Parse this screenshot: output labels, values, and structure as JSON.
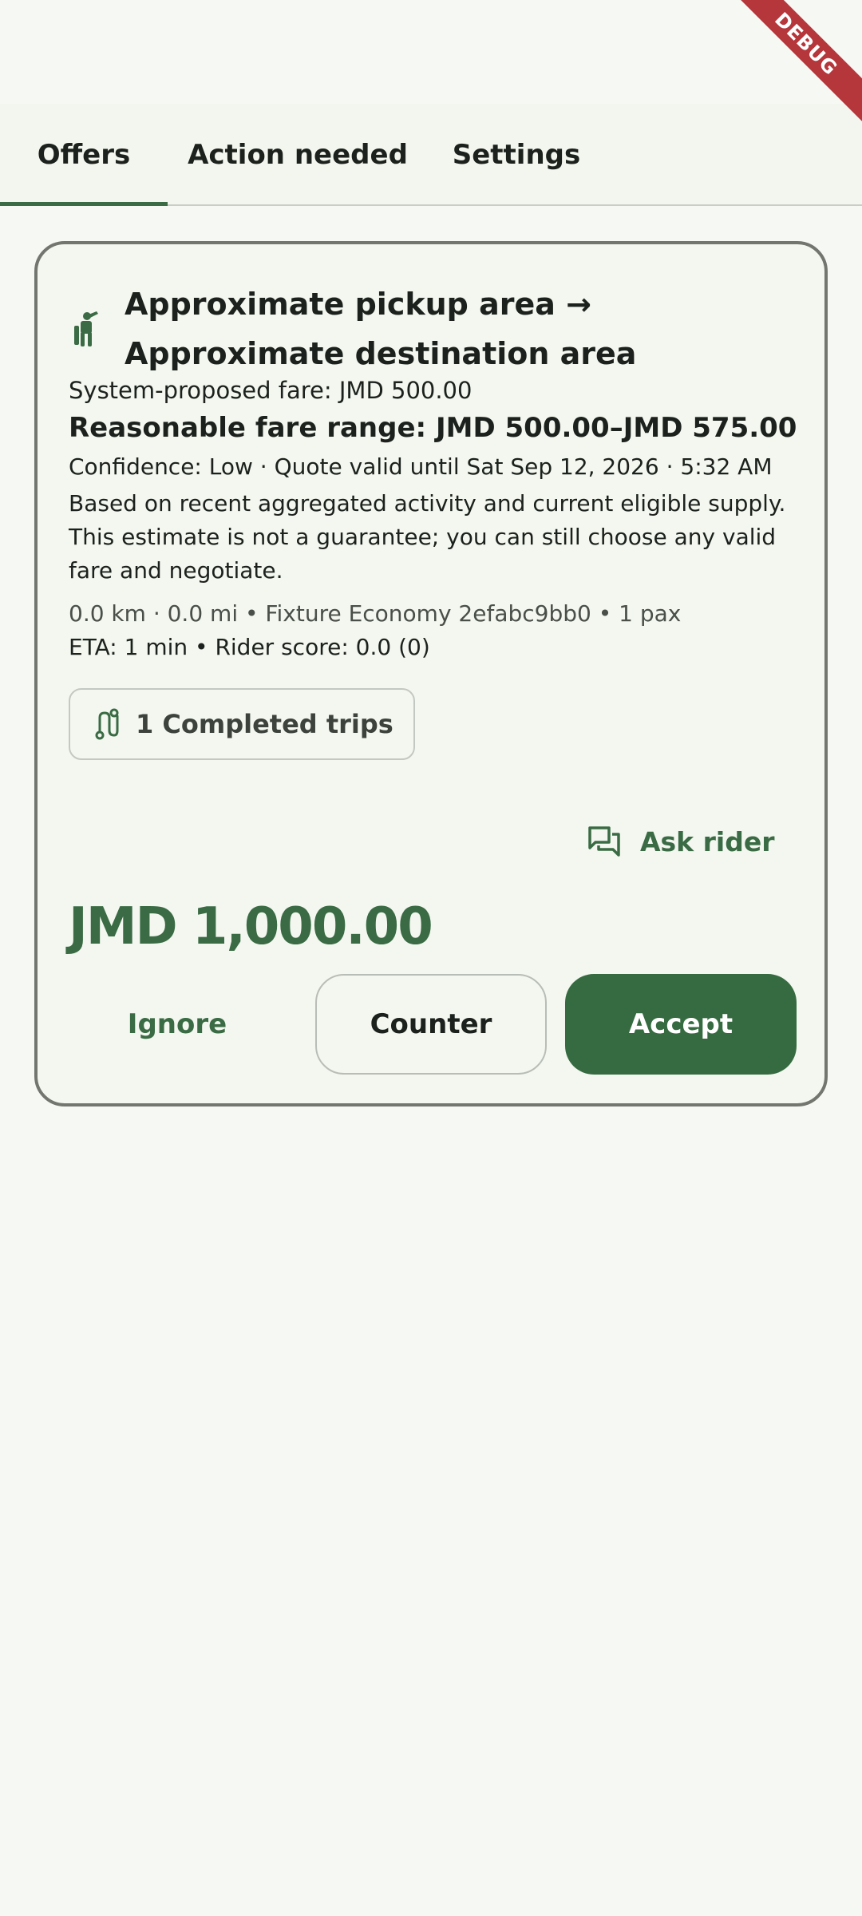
{
  "debug_banner": {
    "label": "DEBUG"
  },
  "tabs": [
    {
      "label": "Offers",
      "selected": true
    },
    {
      "label": "Action needed",
      "selected": false
    },
    {
      "label": "Settings",
      "selected": false
    }
  ],
  "offer": {
    "route_title": "Approximate pickup area → Approximate destination area",
    "system_fare": "System-proposed fare: JMD 500.00",
    "fare_range": "Reasonable fare range: JMD 500.00–JMD 575.00",
    "confidence": "Confidence: Low · Quote valid until Sat Sep 12, 2026 · 5:32 AM",
    "explanation": "Based on recent aggregated activity and current eligible supply. This estimate is not a guarantee; you can still choose any valid fare and negotiate.",
    "trip_meta": "0.0 km · 0.0 mi • Fixture Economy 2efabc9bb0 • 1 pax",
    "eta_score": "ETA: 1 min • Rider score: 0.0 (0)",
    "completed_trips": "1 Completed trips",
    "ask_rider": "Ask rider",
    "price": "JMD 1,000.00",
    "buttons": {
      "ignore": "Ignore",
      "counter": "Counter",
      "accept": "Accept"
    }
  },
  "colors": {
    "accent": "#3a6b44",
    "accept_fill": "#366b41",
    "background": "#f6f8f4",
    "card_border": "#72766f",
    "debug_ribbon": "#b5363b"
  },
  "icons": {
    "route": "person-hailing-icon",
    "trips": "route-icon",
    "ask": "chat-bubbles-icon"
  }
}
